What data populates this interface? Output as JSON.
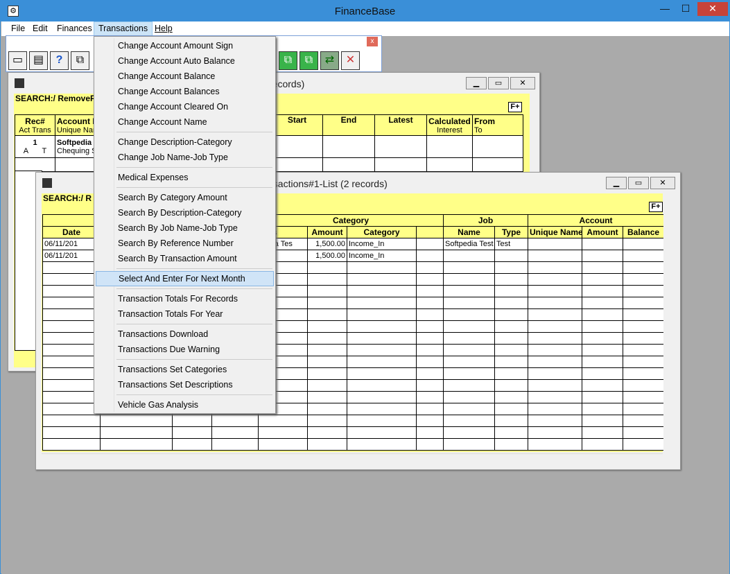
{
  "app": {
    "title": "FinanceBase"
  },
  "menubar": {
    "items": [
      "File",
      "Edit",
      "Finances",
      "Transactions",
      "Help"
    ]
  },
  "toolbar_close": "x",
  "window_buttons": {
    "min": "—",
    "max": "☐",
    "close": "✕"
  },
  "back_window": {
    "title": "records)",
    "search_label": "SEARCH:/ RemoveF",
    "fplus": "F+",
    "columns": [
      {
        "h": "Rec#",
        "s": "Act Trans"
      },
      {
        "h": "Account N",
        "s": "Unique Nam"
      },
      {
        "h": "Start",
        "s": ""
      },
      {
        "h": "End",
        "s": ""
      },
      {
        "h": "Latest",
        "s": ""
      },
      {
        "h": "Calculated",
        "s": "Interest"
      },
      {
        "h": "From",
        "s": "To"
      }
    ],
    "row1": {
      "rec": "1",
      "act": "A",
      "trans": "T",
      "account": "Softpedia",
      "unique": "Chequing S"
    }
  },
  "front_window": {
    "title": "nsactions#1-List (2 records)",
    "search_label": "SEARCH:/ R",
    "fplus": "F+",
    "group_headers": {
      "category": "Category",
      "job": "Job",
      "account": "Account"
    },
    "columns": {
      "date": "Date",
      "notes": "otes",
      "amount": "Amount",
      "category": "Category",
      "job_name": "Name",
      "job_type": "Type",
      "acct_unique": "Unique Name",
      "acct_amount": "Amount",
      "acct_balance": "Balance"
    },
    "rows": [
      {
        "date": "06/11/201",
        "notes": "pedia Tes",
        "amount": "1,500.00",
        "category": "Income_In",
        "job_name": "Softpedia Test",
        "job_type": "Test"
      },
      {
        "date": "06/11/201",
        "notes": "",
        "amount": "1,500.00",
        "category": "Income_In",
        "job_name": "",
        "job_type": ""
      }
    ]
  },
  "dropdown": {
    "items": [
      "Change Account Amount Sign",
      "Change Account Auto Balance",
      "Change Account Balance",
      "Change Account Balances",
      "Change Account Cleared On",
      "Change Account Name",
      "Change Description-Category",
      "Change Job Name-Job Type",
      "Medical Expenses",
      "Search By Category Amount",
      "Search By Description-Category",
      "Search By Job Name-Job Type",
      "Search By Reference Number",
      "Search By Transaction Amount",
      "Select And Enter For Next Month",
      "Transaction Totals For Records",
      "Transaction Totals For Year",
      "Transactions Download",
      "Transactions Due Warning",
      "Transactions Set Categories",
      "Transactions Set Descriptions",
      "Vehicle Gas Analysis"
    ],
    "selected": "Select And Enter For Next Month"
  }
}
